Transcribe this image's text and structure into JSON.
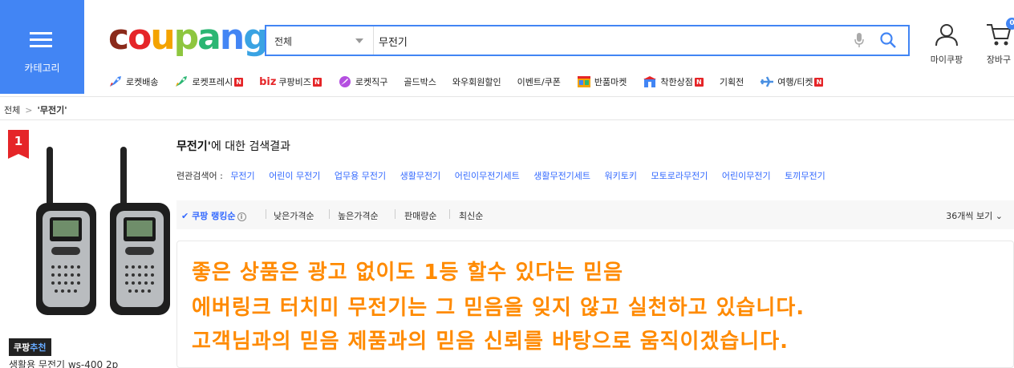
{
  "category": {
    "label": "카테고리"
  },
  "logo": {
    "text": "coupang"
  },
  "search": {
    "scope": "전체",
    "query": "무전기"
  },
  "header": {
    "mypage": "마이쿠팡",
    "cart": "장바구",
    "cart_count": "0"
  },
  "nav": [
    {
      "label": "로켓배송",
      "icon": "rocket-icon",
      "badge": ""
    },
    {
      "label": "로켓프레시",
      "icon": "fresh-rocket-icon",
      "badge": "N"
    },
    {
      "label": "쿠팡비즈",
      "icon": "biz-icon",
      "prefix": "biz",
      "badge": "N"
    },
    {
      "label": "로켓직구",
      "icon": "global-rocket-icon",
      "badge": ""
    },
    {
      "label": "골드박스",
      "icon": "",
      "badge": ""
    },
    {
      "label": "와우회원할인",
      "icon": "",
      "badge": ""
    },
    {
      "label": "이벤트/쿠폰",
      "icon": "",
      "badge": ""
    },
    {
      "label": "반품마켓",
      "icon": "return-market-icon",
      "badge": ""
    },
    {
      "label": "착한상점",
      "icon": "good-store-icon",
      "badge": "N"
    },
    {
      "label": "기획전",
      "icon": "",
      "badge": ""
    },
    {
      "label": "여행/티켓",
      "icon": "airplane-icon",
      "badge": "N"
    }
  ],
  "breadcrumb": {
    "root": "전체",
    "current": "'무전기'"
  },
  "product": {
    "rank": "1",
    "rec_a": "쿠팡",
    "rec_b": "추천",
    "name": "생활용 무전기 ws-400 2p"
  },
  "results": {
    "keyword": "무전기'",
    "suffix": "에 대한 검색결과"
  },
  "related": {
    "header": "련관검색어 :",
    "keywords": [
      "무전기",
      "어린이 무전기",
      "업무용 무전기",
      "생활무전기",
      "어린이무전기세트",
      "생활무전기세트",
      "워키토키",
      "모토로라무전기",
      "어린이무전기",
      "토끼무전기"
    ]
  },
  "sort": {
    "options": [
      "쿠팡 랭킹순",
      "낮은가격순",
      "높은가격순",
      "판매량순",
      "최신순"
    ],
    "active_index": 0,
    "view": "36개씩 보기"
  },
  "banner": {
    "lines": [
      "좋은 상품은 광고 없이도 1등 할수 있다는 믿음",
      "에버링크 터치미 무전기는 그 믿음을 잊지 않고 실천하고 있습니다.",
      "고객님과의 믿음 제품과의 믿음 신뢰를 바탕으로 움직이겠습니다."
    ]
  },
  "colors": {
    "brand_blue": "#4285f4",
    "banner_text": "#ff8a00",
    "badge_red": "#e52528",
    "link_blue": "#346aff"
  }
}
